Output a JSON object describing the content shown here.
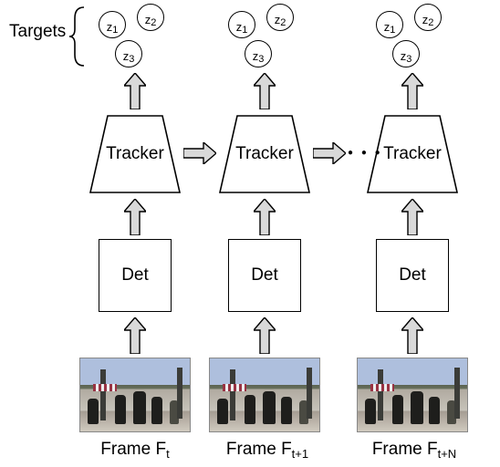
{
  "targets_label": "Targets",
  "z_labels": {
    "z1": "z",
    "z1_sub": "1",
    "z2": "z",
    "z2_sub": "2",
    "z3": "z",
    "z3_sub": "3"
  },
  "tracker_label": "Tracker",
  "det_label": "Det",
  "frames": {
    "f1": {
      "prefix": "Frame F",
      "sub": "t"
    },
    "f2": {
      "prefix": "Frame F",
      "sub": "t+1"
    },
    "f3": {
      "prefix": "Frame F",
      "sub": "t+N"
    }
  },
  "ellipsis": "● ● ●",
  "colors": {
    "arrow_fill": "#d9d9d9",
    "stroke": "#000000"
  }
}
